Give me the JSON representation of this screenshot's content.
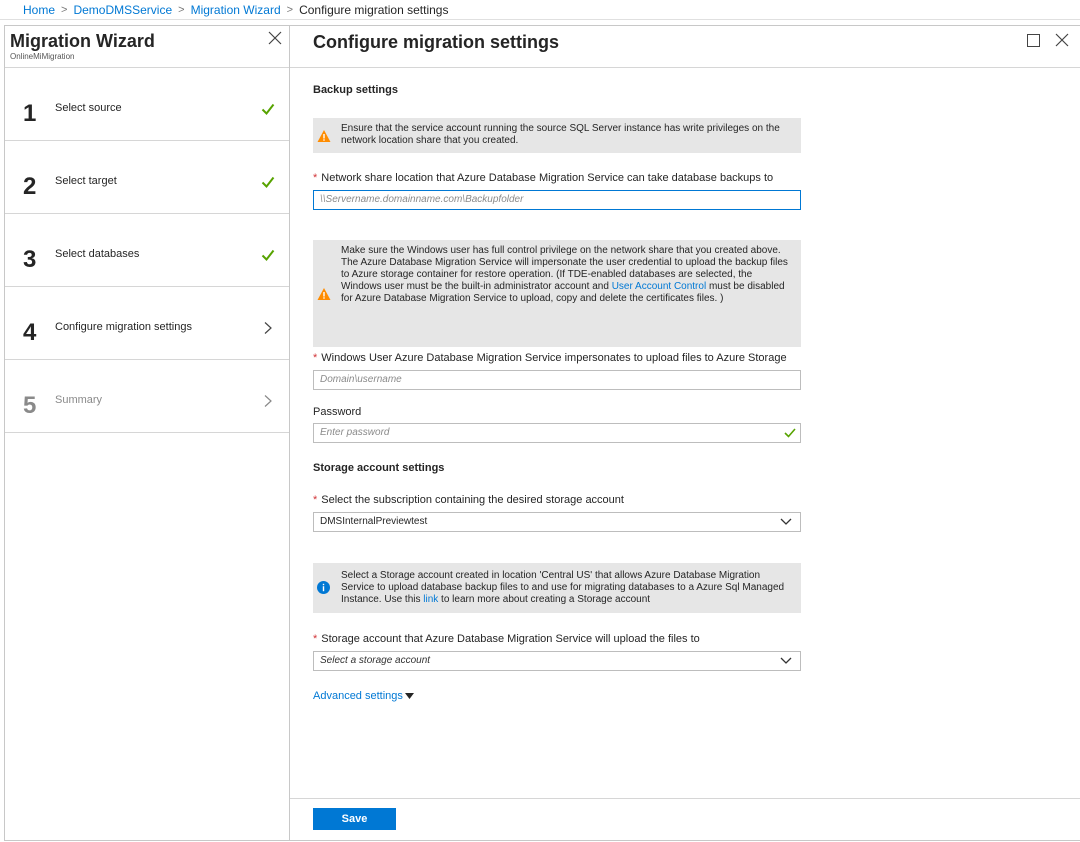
{
  "breadcrumb": {
    "items": [
      "Home",
      "DemoDMSService",
      "Migration Wizard"
    ],
    "current": "Configure migration settings"
  },
  "wizard": {
    "title": "Migration Wizard",
    "subtitle": "OnlineMiMigration",
    "steps": [
      {
        "number": "1",
        "label": "Select source",
        "state": "complete"
      },
      {
        "number": "2",
        "label": "Select target",
        "state": "complete"
      },
      {
        "number": "3",
        "label": "Select databases",
        "state": "complete"
      },
      {
        "number": "4",
        "label": "Configure migration settings",
        "state": "active"
      },
      {
        "number": "5",
        "label": "Summary",
        "state": "disabled"
      }
    ]
  },
  "main": {
    "title": "Configure migration settings",
    "backup_section": "Backup settings",
    "warning1": "Ensure that the service account running the source SQL Server instance has write privileges on the network location share that you created.",
    "network_share_label": "Network share location that Azure Database Migration Service can take database backups to",
    "network_share_placeholder": "\\\\Servername.domainname.com\\Backupfolder",
    "warning2_part1": "Make sure the Windows user has full control privilege on the network share that you created above. The Azure Database Migration Service will impersonate the user credential to upload the backup files to Azure storage container for restore operation. (If TDE-enabled databases are selected, the Windows user must be the built-in administrator account and ",
    "warning2_link": "User Account Control",
    "warning2_part2": " must be disabled for Azure Database Migration Service to upload, copy and delete the certificates files. )",
    "windows_user_label": "Windows User Azure Database Migration Service impersonates to upload files to Azure Storage",
    "windows_user_placeholder": "Domain\\username",
    "password_label": "Password",
    "password_placeholder": "Enter password",
    "storage_section": "Storage account settings",
    "subscription_label": "Select the subscription containing the desired storage account",
    "subscription_value": "DMSInternalPreviewtest",
    "info_part1": "Select a Storage account created in location 'Central US' that allows Azure Database Migration Service to upload database backup files to and use for migrating databases to a Azure Sql Managed Instance. Use this ",
    "info_link": "link",
    "info_part2": " to learn more about creating a Storage account",
    "storage_account_label": "Storage account that Azure Database Migration Service will upload the files to",
    "storage_account_placeholder": "Select a storage account",
    "advanced_settings": "Advanced settings",
    "save_label": "Save"
  },
  "colors": {
    "accent": "#0078d4",
    "success": "#57a300",
    "warning": "#ff8c00",
    "required": "#d13438",
    "banner_bg": "#e6e6e6"
  },
  "icons": {
    "close": "close-icon",
    "check": "checkmark-icon",
    "chevron_right": "chevron-right-icon",
    "chevron_down": "chevron-down-icon",
    "warning": "warning-icon",
    "info": "info-icon",
    "maximize": "maximize-icon"
  }
}
